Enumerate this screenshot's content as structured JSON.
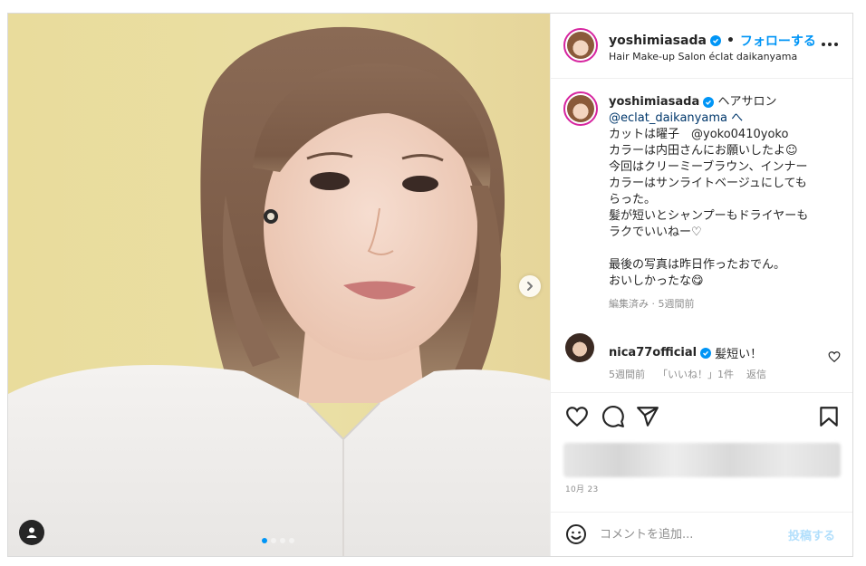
{
  "post": {
    "username": "yoshimiasada",
    "follow_label": "フォローする",
    "location": "Hair Make-up Salon éclat daikanyama",
    "bullet": "•"
  },
  "caption": {
    "username": "yoshimiasada",
    "lines": [
      "ヘアサロン",
      "@eclat_daikanyama へ",
      "カットは曜子　@yoko0410yoko",
      "カラーは内田さんにお願いしたよ☺",
      "今回はクリーミーブラウン、インナー",
      "カラーはサンライトベージュにしても",
      "らった。",
      "髪が短いとシャンプーもドライヤーも",
      "ラクでいいねー♡",
      "",
      "最後の写真は昨日作ったおでん。",
      "おいしかったな😋"
    ],
    "meta": "編集済み · 5週間前"
  },
  "comment": {
    "username": "nica77official",
    "text": "髪短い！",
    "time": "5週間前",
    "likes": "「いいね！」1件",
    "reply": "返信"
  },
  "post_footer": {
    "date": "10月 23"
  },
  "add_comment": {
    "placeholder": "コメントを追加...",
    "post_label": "投稿する"
  },
  "icons": {
    "like": "heart-icon",
    "comment": "comment-icon",
    "share": "share-icon",
    "save": "bookmark-icon",
    "emoji": "emoji-icon",
    "more": "more-icon",
    "next": "chevron-right-icon",
    "tags": "user-tag-icon",
    "verified": "verified-icon"
  },
  "colors": {
    "accent": "#0095f6",
    "post_button_disabled": "#b2dffc",
    "meta_text": "#8e8e8e"
  },
  "carousel": {
    "total_slides": 4,
    "active_slide": 1
  }
}
